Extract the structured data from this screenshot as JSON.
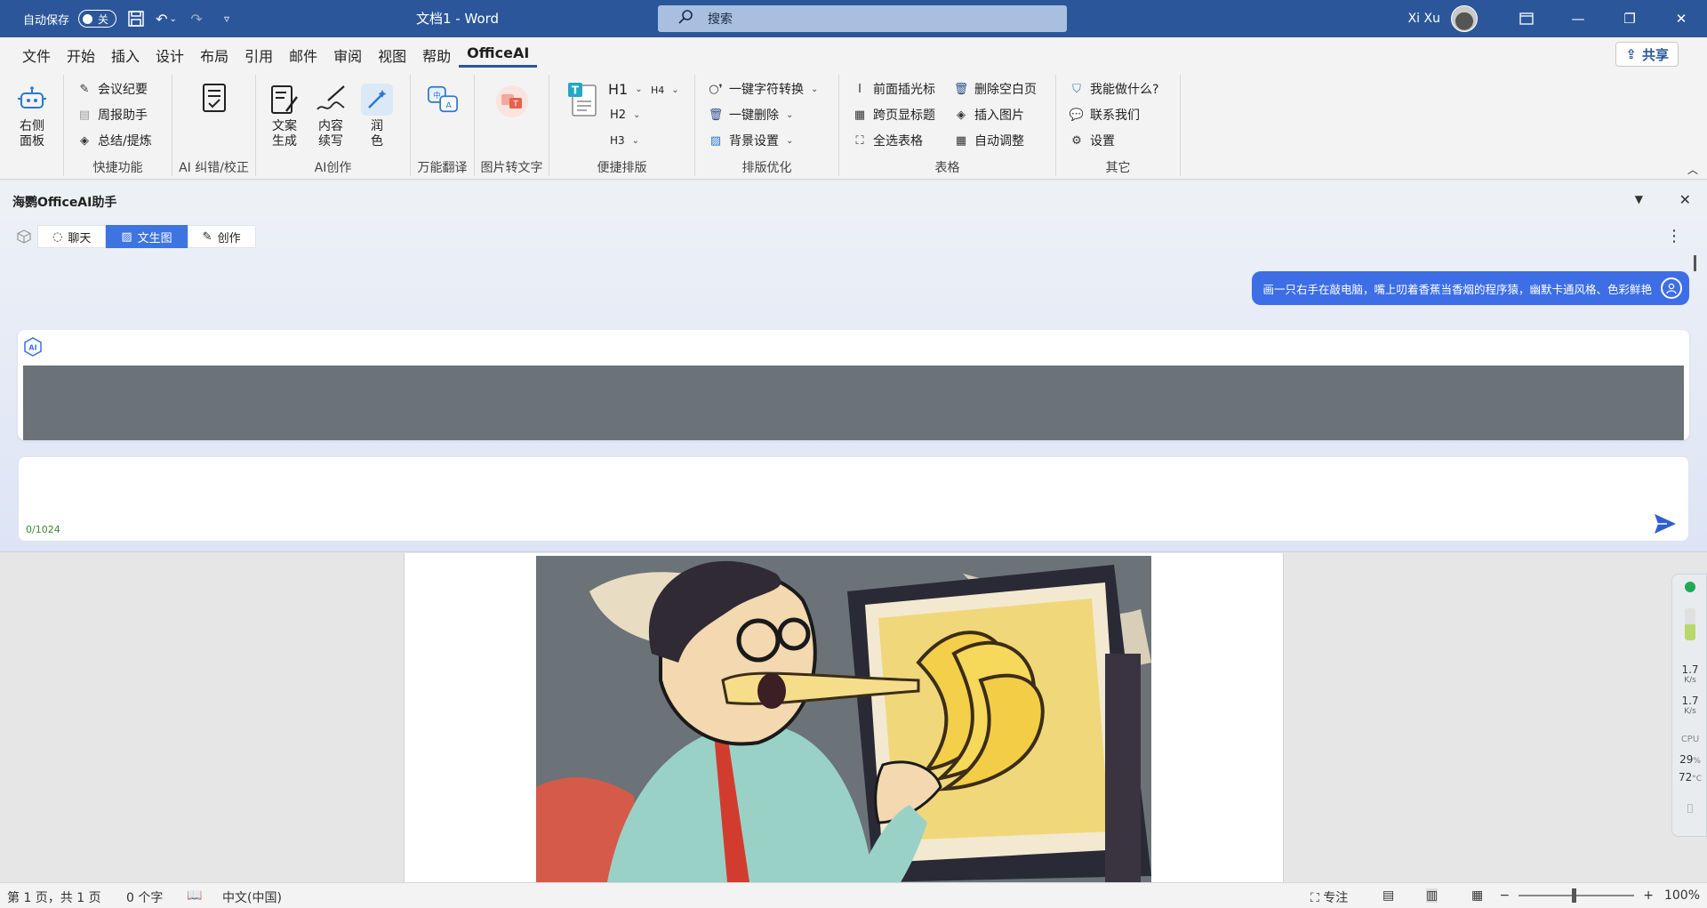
{
  "titlebar": {
    "autosave_label": "自动保存",
    "autosave_state": "关",
    "doc_title": "文档1  -  Word",
    "search_placeholder": "搜索",
    "user_name": "Xi Xu"
  },
  "menu": {
    "tabs": [
      "文件",
      "开始",
      "插入",
      "设计",
      "布局",
      "引用",
      "邮件",
      "审阅",
      "视图",
      "帮助",
      "OfficeAI"
    ],
    "active": "OfficeAI",
    "share_label": "共享"
  },
  "ribbon": {
    "right_panel": "右侧\n面板",
    "quick": {
      "items": [
        "会议纪要",
        "周报助手",
        "总结/提炼"
      ],
      "label": "快捷功能"
    },
    "correct": {
      "label": "AI 纠错/校正"
    },
    "create": {
      "items": [
        "文案\n生成",
        "内容\n续写",
        "润\n色"
      ],
      "label": "AI创作"
    },
    "translate": {
      "label": "万能翻译"
    },
    "img2text": {
      "label": "图片转文字"
    },
    "layout": {
      "h1": "H1",
      "h2": "H2",
      "h3": "H3",
      "h4": "H4",
      "label": "便捷排版"
    },
    "typeset": {
      "items": [
        "一键字符转换",
        "一键删除",
        "背景设置"
      ],
      "label": "排版优化"
    },
    "table": {
      "items": [
        "前面插光标",
        "删除空白页",
        "跨页显标题",
        "插入图片",
        "全选表格",
        "自动调整"
      ],
      "label": "表格"
    },
    "other": {
      "items": [
        "我能做什么?",
        "联系我们",
        "设置"
      ],
      "label": "其它"
    }
  },
  "assistant": {
    "title": "海鹦OfficeAI助手",
    "tabs": [
      "聊天",
      "文生图",
      "创作"
    ],
    "active_tab": "文生图",
    "user_prompt": "画一只右手在敲电脑，嘴上叨着香蕉当香烟的程序猿，幽默卡通风格、色彩鲜艳",
    "ai_badge": "AI",
    "counter": "0/1024"
  },
  "widget": {
    "up": "1.7",
    "up_unit": "K/s",
    "down": "1.7",
    "down_unit": "K/s",
    "cpu_label": "CPU",
    "cpu_pct": "29",
    "cpu_pct_unit": "%",
    "cpu_temp": "72",
    "cpu_temp_unit": "°C"
  },
  "statusbar": {
    "page": "第 1 页，共 1 页",
    "words": "0 个字",
    "lang": "中文(中国)",
    "focus": "专注",
    "zoom": "100%"
  },
  "colors": {
    "titlebar": "#2b579a",
    "accent_blue": "#3d6ee6",
    "counter_green": "#3a8a2f"
  }
}
